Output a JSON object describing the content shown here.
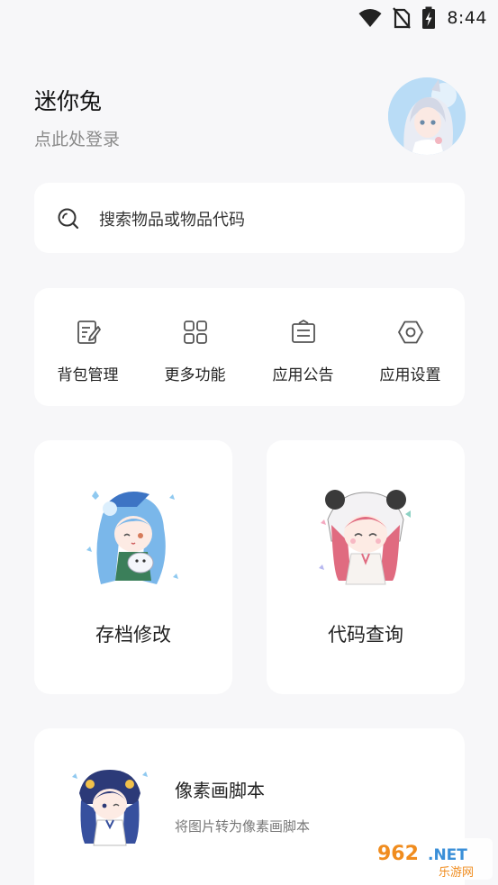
{
  "status_bar": {
    "time": "8:44",
    "icons": [
      "wifi-icon",
      "no-sim-icon",
      "battery-charging-icon"
    ]
  },
  "header": {
    "title": "迷你兔",
    "login_text": "点此处登录"
  },
  "search": {
    "placeholder": "搜索物品或物品代码",
    "icon": "search-icon"
  },
  "quick_actions": [
    {
      "label": "背包管理",
      "icon": "edit-note-icon"
    },
    {
      "label": "更多功能",
      "icon": "grid-icon"
    },
    {
      "label": "应用公告",
      "icon": "announcement-box-icon"
    },
    {
      "label": "应用设置",
      "icon": "hexagon-settings-icon"
    }
  ],
  "features": [
    {
      "label": "存档修改",
      "icon": "blue-hair-girl-illustration"
    },
    {
      "label": "代码查询",
      "icon": "panda-hood-girl-illustration"
    }
  ],
  "script_card": {
    "title": "像素画脚本",
    "subtitle": "将图片转为像素画脚本",
    "icon": "navy-hair-girl-illustration"
  },
  "watermark": {
    "text_top": "962.NET",
    "text_bottom": "乐游网"
  },
  "colors": {
    "background": "#f7f7f9",
    "card": "#ffffff",
    "icon_stroke": "#555555",
    "secondary_text": "#8a8a8a"
  }
}
